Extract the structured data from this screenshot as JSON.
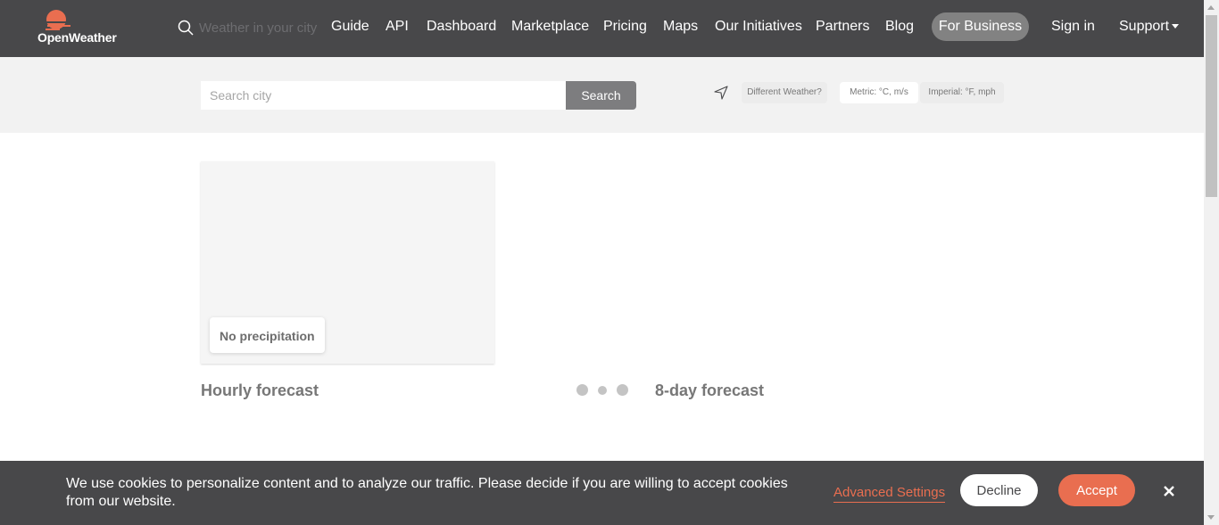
{
  "colors": {
    "nav_bg": "#48484a",
    "brand_orange": "#e96e50",
    "search_bg": "#f2f2f2",
    "business_pill": "#828282"
  },
  "logo": {
    "text": "OpenWeather",
    "icon": "sun-logo-icon"
  },
  "nav": {
    "search_placeholder": "Weather in your city",
    "guide": "Guide",
    "api": "API",
    "dashboard": "Dashboard",
    "marketplace": "Marketplace",
    "pricing": "Pricing",
    "maps": "Maps",
    "initiatives": "Our Initiatives",
    "partners": "Partners",
    "blog": "Blog",
    "business": "For Business",
    "signin": "Sign in",
    "support": "Support"
  },
  "search": {
    "placeholder": "Search city",
    "button": "Search",
    "different_weather": "Different Weather?",
    "metric": "Metric: °C, m/s",
    "imperial": "Imperial: °F, mph"
  },
  "main": {
    "precipitation": "No precipitation",
    "hourly_title": "Hourly forecast",
    "daily_title": "8-day forecast"
  },
  "cookie": {
    "text": "We use cookies to personalize content and to analyze our traffic. Please decide if you are willing to accept cookies from our website.",
    "advanced": "Advanced Settings",
    "decline": "Decline",
    "accept": "Accept"
  }
}
